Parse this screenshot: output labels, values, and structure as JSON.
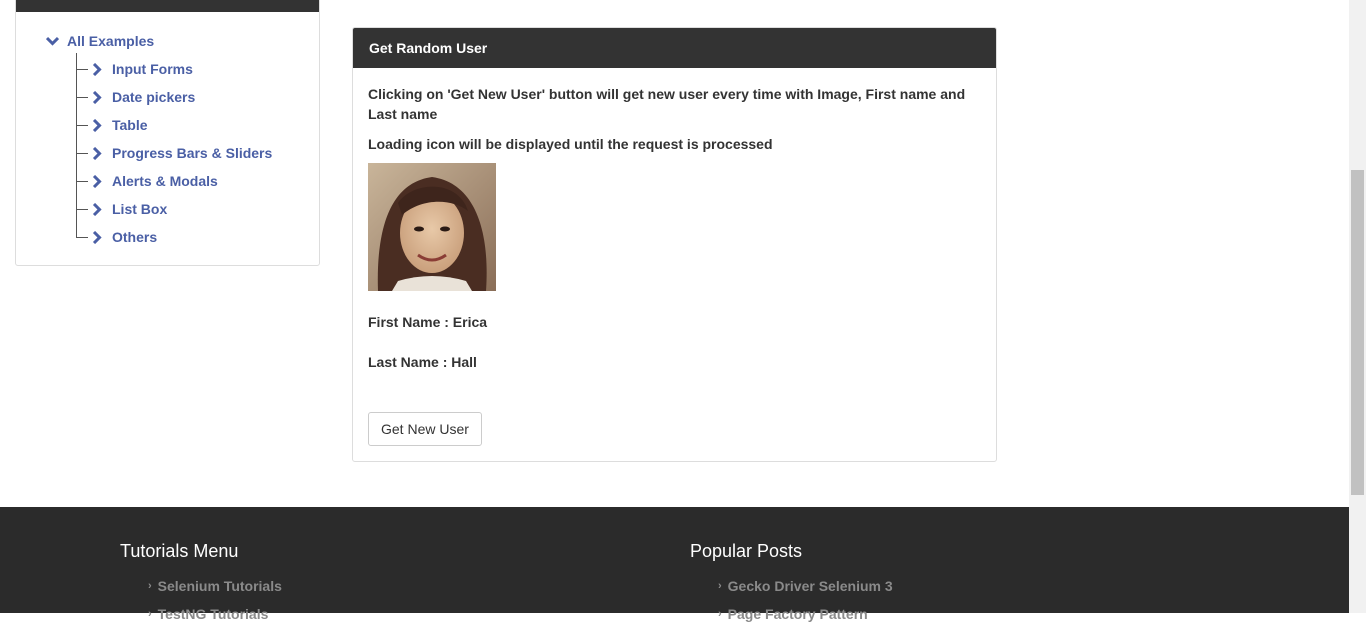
{
  "sidebar": {
    "root": {
      "label": "All Examples",
      "icon": "chevron-down-icon"
    },
    "items": [
      {
        "label": "Input Forms"
      },
      {
        "label": "Date pickers"
      },
      {
        "label": "Table"
      },
      {
        "label": "Progress Bars & Sliders"
      },
      {
        "label": "Alerts & Modals"
      },
      {
        "label": "List Box"
      },
      {
        "label": "Others"
      }
    ]
  },
  "panel": {
    "title": "Get Random User",
    "description1": "Clicking on 'Get New User' button will get new user every time with Image, First name and Last name",
    "description2": "Loading icon will be displayed until the request is processed",
    "first_name": "First Name : Erica",
    "last_name": "Last Name : Hall",
    "button_label": "Get New User"
  },
  "footer": {
    "tutorials": {
      "title": "Tutorials Menu",
      "links": [
        "Selenium Tutorials",
        "TestNG Tutorials"
      ]
    },
    "popular": {
      "title": "Popular Posts",
      "links": [
        "Gecko Driver Selenium 3",
        "Page Factory Pattern"
      ]
    }
  },
  "colors": {
    "link": "#4a5fa5",
    "header_bg": "#333333",
    "footer_bg": "#2b2b2b"
  }
}
